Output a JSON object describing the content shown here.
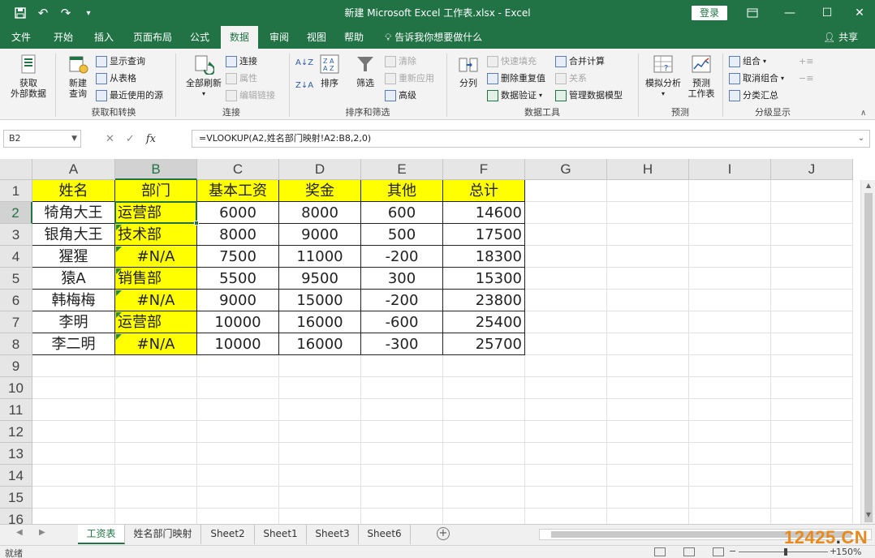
{
  "window": {
    "title": "新建 Microsoft Excel 工作表.xlsx  -  Excel",
    "login": "登录",
    "controls": [
      "restore-ribbon",
      "minimize",
      "maximize",
      "close"
    ]
  },
  "tabs": [
    {
      "label": "文件"
    },
    {
      "label": "开始"
    },
    {
      "label": "插入"
    },
    {
      "label": "页面布局"
    },
    {
      "label": "公式"
    },
    {
      "label": "数据",
      "active": true
    },
    {
      "label": "审阅"
    },
    {
      "label": "视图"
    },
    {
      "label": "帮助"
    }
  ],
  "tell_me": "告诉我你想要做什么",
  "share": "共享",
  "ribbon": {
    "get_external": "获取\n外部数据",
    "new_query": "新建\n查询",
    "show_queries": "显示查询",
    "from_table": "从表格",
    "recent_sources": "最近使用的源",
    "group_get_transform": "获取和转换",
    "refresh_all": "全部刷新",
    "connections": "连接",
    "properties": "属性",
    "edit_links": "编辑链接",
    "group_connections": "连接",
    "sort": "排序",
    "filter": "筛选",
    "clear": "清除",
    "reapply": "重新应用",
    "advanced": "高级",
    "group_sort_filter": "排序和筛选",
    "split": "分列",
    "flash_fill": "快速填充",
    "remove_dup": "删除重复值",
    "validation": "数据验证",
    "consolidate": "合并计算",
    "relationships": "关系",
    "data_model": "管理数据模型",
    "group_data_tools": "数据工具",
    "what_if": "模拟分析",
    "forecast": "预测\n工作表",
    "group_forecast": "预测",
    "group_btn": "组合",
    "ungroup": "取消组合",
    "subtotal": "分类汇总",
    "group_outline": "分级显示"
  },
  "formula_bar": {
    "name_box": "B2",
    "formula": "=VLOOKUP(A2,姓名部门映射!A2:B8,2,0)"
  },
  "columns": [
    "A",
    "B",
    "C",
    "D",
    "E",
    "F",
    "G",
    "H",
    "I",
    "J"
  ],
  "rows": [
    "1",
    "2",
    "3",
    "4",
    "5",
    "6",
    "7",
    "8",
    "9",
    "10",
    "11",
    "12",
    "13",
    "14",
    "15",
    "16"
  ],
  "table": {
    "headers": [
      "姓名",
      "部门",
      "基本工资",
      "奖金",
      "其他",
      "总计"
    ],
    "rows": [
      [
        "犄角大王",
        "运营部",
        "6000",
        "8000",
        "600",
        "14600"
      ],
      [
        "银角大王",
        "技术部",
        "8000",
        "9000",
        "500",
        "17500"
      ],
      [
        "猩猩",
        "#N/A",
        "7500",
        "11000",
        "-200",
        "18300"
      ],
      [
        "猿A",
        "销售部",
        "5500",
        "9500",
        "300",
        "15300"
      ],
      [
        "韩梅梅",
        "#N/A",
        "9000",
        "15000",
        "-200",
        "23800"
      ],
      [
        "李明",
        "运营部",
        "10000",
        "16000",
        "-600",
        "25400"
      ],
      [
        "李二明",
        "#N/A",
        "10000",
        "16000",
        "-300",
        "25700"
      ]
    ]
  },
  "sheets": [
    {
      "label": "工资表",
      "active": true
    },
    {
      "label": "姓名部门映射"
    },
    {
      "label": "Sheet2"
    },
    {
      "label": "Sheet1"
    },
    {
      "label": "Sheet3"
    },
    {
      "label": "Sheet6"
    }
  ],
  "status": {
    "ready": "就绪",
    "zoom": "150%"
  },
  "watermark": {
    "num": "12425",
    "dot": ".",
    "tld": "CN"
  },
  "colors": {
    "accent": "#217346",
    "highlight": "#ffff00",
    "error_flag": "#1e8c45"
  }
}
